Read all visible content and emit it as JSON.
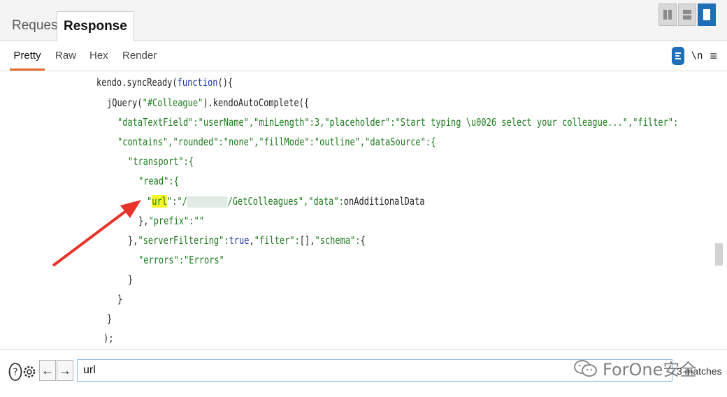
{
  "tabs": {
    "request": "Request",
    "response": "Response"
  },
  "subtabs": {
    "pretty": "Pretty",
    "raw": "Raw",
    "hex": "Hex",
    "render": "Render"
  },
  "tools": {
    "newline": "\\n",
    "menu": "≡"
  },
  "code": {
    "l1a": "kendo.syncReady(",
    "l1b": "function",
    "l1c": "(){",
    "l2a": "jQuery(",
    "l2b": "\"#Colleague\"",
    "l2c": ").kendoAutoComplete({",
    "l3": "\"dataTextField\":\"userName\",\"minLength\":3,\"placeholder\":\"Start typing \\u0026 select your colleague...\",\"filter\":",
    "l4": "\"contains\",\"rounded\":\"none\",\"fillMode\":\"outline\",\"dataSource\":{",
    "l5": "\"transport\":{",
    "l6": "\"read\":{",
    "l7a": "\"",
    "l7b": "url",
    "l7c": "\":\"/",
    "l7d": "/GetColleagues\",\"data\":",
    "l7e": "onAdditionalData",
    "l8a": "},",
    "l8b": "\"prefix\":\"\"",
    "l9a": "},",
    "l9b": "\"serverFiltering\":",
    "l9c": "true",
    "l9d": ",",
    "l9e": "\"filter\":",
    "l9f": "[],",
    "l9g": "\"schema\":",
    "l9h": "{",
    "l10": "\"errors\":\"Errors\"",
    "l11": "}",
    "l12": "}",
    "l13": "}",
    "l14": ");"
  },
  "search": {
    "value": "url"
  },
  "status": {
    "matches": "3 matches"
  },
  "watermark": {
    "text": "ForOne安全"
  },
  "colors": {
    "accent": "#1f6fb8",
    "tab_underline": "#e86a2b",
    "string": "#1a7a1a",
    "keyword": "#1a35a8",
    "highlight": "#f5f52a",
    "arrow": "#e8332a"
  }
}
